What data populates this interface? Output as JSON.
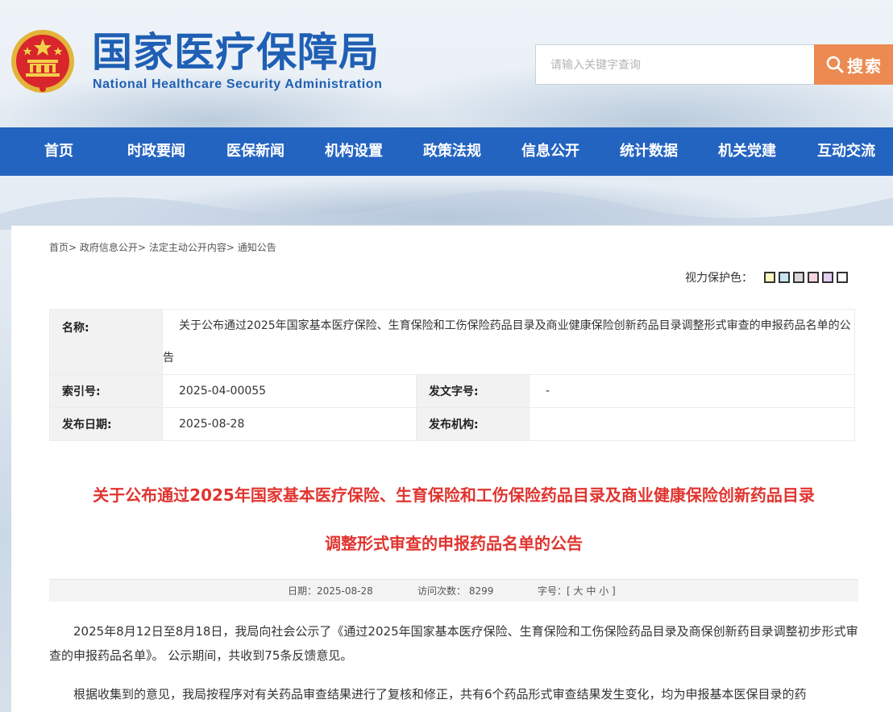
{
  "site": {
    "name_cn": "国家医疗保障局",
    "name_en": "National Healthcare Security Administration"
  },
  "search": {
    "placeholder": "请输入关键字查询",
    "button_label": "搜索"
  },
  "nav": {
    "items": [
      "首页",
      "时政要闻",
      "医保新闻",
      "机构设置",
      "政策法规",
      "信息公开",
      "统计数据",
      "机关党建",
      "互动交流"
    ]
  },
  "breadcrumb": {
    "items": [
      "首页",
      "政府信息公开",
      "法定主动公开内容",
      "通知公告"
    ],
    "separator": ">"
  },
  "eye_protect": {
    "label": "视力保护色：",
    "colors": [
      "#fbf6bf",
      "#c6e6f1",
      "#d8d8d8",
      "#f6d6dd",
      "#e3cff0",
      "#ffffff"
    ]
  },
  "info": {
    "name_label": "名称:",
    "name_value": "关于公布通过2025年国家基本医疗保险、生育保险和工伤保险药品目录及商业健康保险创新药品目录调整形式审查的申报药品名单的公告",
    "index_label": "索引号:",
    "index_value": "2025-04-00055",
    "doc_no_label": "发文字号:",
    "doc_no_value": "-",
    "date_label": "发布日期:",
    "date_value": "2025-08-28",
    "org_label": "发布机构:",
    "org_value": ""
  },
  "article": {
    "title_line1": "关于公布通过2025年国家基本医疗保险、生育保险和工伤保险药品目录及商业健康保险创新药品目录",
    "title_line2": "调整形式审查的申报药品名单的公告",
    "meta_date": "日期：2025-08-28",
    "meta_visits": "访问次数： 8299",
    "meta_font_label": "字号：[",
    "font_large": "大",
    "font_medium": "中",
    "font_small": "小",
    "meta_font_end": "]",
    "paragraph1": "2025年8月12日至8月18日，我局向社会公示了《通过2025年国家基本医疗保险、生育保险和工伤保险药品目录及商保创新药目录调整初步形式审查的申报药品名单》。 公示期间，共收到75条反馈意见。",
    "paragraph2": "根据收集到的意见，我局按程序对有关药品审查结果进行了复核和修正，共有6个药品形式审查结果发生变化，均为申报基本医保目录的药"
  },
  "colors": {
    "brand_blue": "#1f5fb4",
    "nav_blue": "#2464c1",
    "search_orange": "#ec8a52",
    "title_red": "#e0342f"
  },
  "icons": [
    "national-emblem-icon",
    "search-icon"
  ]
}
